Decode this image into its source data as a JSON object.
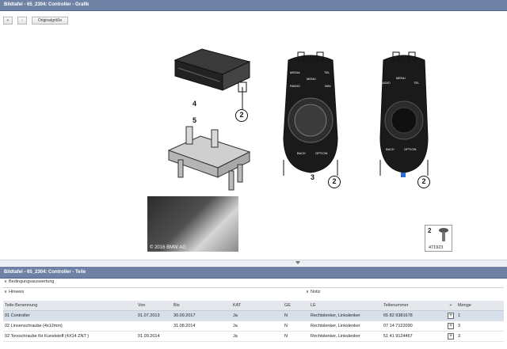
{
  "graphic_panel": {
    "title": "Bildtafel - 65_2304: Controller - Grafik"
  },
  "toolbar": {
    "zoom_in_label": "+",
    "zoom_out_label": "-",
    "original_size_label": "Originalgröße"
  },
  "callouts": {
    "module": "4",
    "bracket": "5",
    "screw_1": "2",
    "controller_left": "3",
    "screw_2": "2",
    "screw_3": "2",
    "thumb_number": "2",
    "thumb_id": "471923"
  },
  "controller_left_buttons": {
    "media": "MEDIA",
    "tel": "TEL",
    "menu": "MENU",
    "radio": "RADIO",
    "nav": "NAV",
    "back": "BACK",
    "option": "OPTION"
  },
  "controller_right_buttons": {
    "audio": "AUDIO",
    "menu": "MENU",
    "tel": "TEL",
    "back": "BACK",
    "option": "OPTION"
  },
  "photo": {
    "copyright": "© 2016 BMW AG"
  },
  "parts_panel": {
    "title": "Bildtafel - 65_2304: Controller - Teile",
    "bedingung": "Bedingungsauswertung",
    "hinweis": "Hinweis",
    "notiz": "Notiz"
  },
  "table": {
    "headers": [
      "Teile-Benennung",
      "Von",
      "Bis",
      "KAT",
      "GE",
      "LE",
      "Teilenummer",
      "+",
      "Menge"
    ],
    "rows": [
      {
        "name": "01 Controller",
        "von": "01.07.2013",
        "bis": "30.09.2017",
        "kat": "Ja",
        "ge": "N",
        "le": "Rechtslenker, Linkslenker",
        "teilenummer": "65 82 9381678",
        "menge": "1"
      },
      {
        "name": "02 Linsenschraube (4x12mm)",
        "von": "",
        "bis": "31.08.2014",
        "kat": "Ja",
        "ge": "N",
        "le": "Rechtslenker, Linkslenker",
        "teilenummer": "07 14 7122090",
        "menge": "3"
      },
      {
        "name": "02 Torxschraube für Kunststoff (4X14 ZNT )",
        "von": "01.09.2014",
        "bis": "",
        "kat": "Ja",
        "ge": "N",
        "le": "Rechtslenker, Linkslenker",
        "teilenummer": "51 41 9124467",
        "menge": "3"
      }
    ]
  },
  "colors": {
    "title_bar": "#6f82a6",
    "selected_row": "#d7dfeb"
  }
}
